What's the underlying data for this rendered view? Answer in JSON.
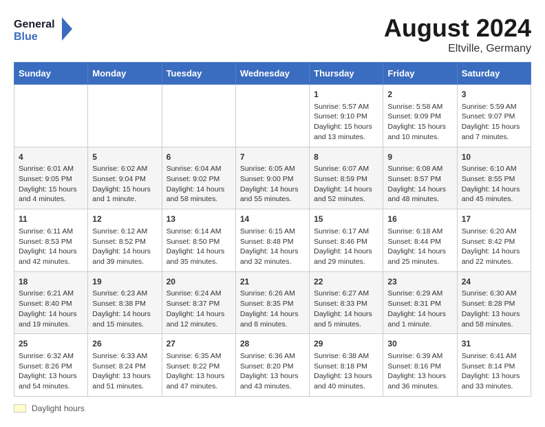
{
  "header": {
    "logo_general": "General",
    "logo_blue": "Blue",
    "month": "August 2024",
    "location": "Eltville, Germany"
  },
  "days_of_week": [
    "Sunday",
    "Monday",
    "Tuesday",
    "Wednesday",
    "Thursday",
    "Friday",
    "Saturday"
  ],
  "legend": {
    "label": "Daylight hours"
  },
  "weeks": [
    {
      "days": [
        {
          "num": "",
          "info": ""
        },
        {
          "num": "",
          "info": ""
        },
        {
          "num": "",
          "info": ""
        },
        {
          "num": "",
          "info": ""
        },
        {
          "num": "1",
          "info": "Sunrise: 5:57 AM\nSunset: 9:10 PM\nDaylight: 15 hours\nand 13 minutes."
        },
        {
          "num": "2",
          "info": "Sunrise: 5:58 AM\nSunset: 9:09 PM\nDaylight: 15 hours\nand 10 minutes."
        },
        {
          "num": "3",
          "info": "Sunrise: 5:59 AM\nSunset: 9:07 PM\nDaylight: 15 hours\nand 7 minutes."
        }
      ]
    },
    {
      "days": [
        {
          "num": "4",
          "info": "Sunrise: 6:01 AM\nSunset: 9:05 PM\nDaylight: 15 hours\nand 4 minutes."
        },
        {
          "num": "5",
          "info": "Sunrise: 6:02 AM\nSunset: 9:04 PM\nDaylight: 15 hours\nand 1 minute."
        },
        {
          "num": "6",
          "info": "Sunrise: 6:04 AM\nSunset: 9:02 PM\nDaylight: 14 hours\nand 58 minutes."
        },
        {
          "num": "7",
          "info": "Sunrise: 6:05 AM\nSunset: 9:00 PM\nDaylight: 14 hours\nand 55 minutes."
        },
        {
          "num": "8",
          "info": "Sunrise: 6:07 AM\nSunset: 8:59 PM\nDaylight: 14 hours\nand 52 minutes."
        },
        {
          "num": "9",
          "info": "Sunrise: 6:08 AM\nSunset: 8:57 PM\nDaylight: 14 hours\nand 48 minutes."
        },
        {
          "num": "10",
          "info": "Sunrise: 6:10 AM\nSunset: 8:55 PM\nDaylight: 14 hours\nand 45 minutes."
        }
      ]
    },
    {
      "days": [
        {
          "num": "11",
          "info": "Sunrise: 6:11 AM\nSunset: 8:53 PM\nDaylight: 14 hours\nand 42 minutes."
        },
        {
          "num": "12",
          "info": "Sunrise: 6:12 AM\nSunset: 8:52 PM\nDaylight: 14 hours\nand 39 minutes."
        },
        {
          "num": "13",
          "info": "Sunrise: 6:14 AM\nSunset: 8:50 PM\nDaylight: 14 hours\nand 35 minutes."
        },
        {
          "num": "14",
          "info": "Sunrise: 6:15 AM\nSunset: 8:48 PM\nDaylight: 14 hours\nand 32 minutes."
        },
        {
          "num": "15",
          "info": "Sunrise: 6:17 AM\nSunset: 8:46 PM\nDaylight: 14 hours\nand 29 minutes."
        },
        {
          "num": "16",
          "info": "Sunrise: 6:18 AM\nSunset: 8:44 PM\nDaylight: 14 hours\nand 25 minutes."
        },
        {
          "num": "17",
          "info": "Sunrise: 6:20 AM\nSunset: 8:42 PM\nDaylight: 14 hours\nand 22 minutes."
        }
      ]
    },
    {
      "days": [
        {
          "num": "18",
          "info": "Sunrise: 6:21 AM\nSunset: 8:40 PM\nDaylight: 14 hours\nand 19 minutes."
        },
        {
          "num": "19",
          "info": "Sunrise: 6:23 AM\nSunset: 8:38 PM\nDaylight: 14 hours\nand 15 minutes."
        },
        {
          "num": "20",
          "info": "Sunrise: 6:24 AM\nSunset: 8:37 PM\nDaylight: 14 hours\nand 12 minutes."
        },
        {
          "num": "21",
          "info": "Sunrise: 6:26 AM\nSunset: 8:35 PM\nDaylight: 14 hours\nand 8 minutes."
        },
        {
          "num": "22",
          "info": "Sunrise: 6:27 AM\nSunset: 8:33 PM\nDaylight: 14 hours\nand 5 minutes."
        },
        {
          "num": "23",
          "info": "Sunrise: 6:29 AM\nSunset: 8:31 PM\nDaylight: 14 hours\nand 1 minute."
        },
        {
          "num": "24",
          "info": "Sunrise: 6:30 AM\nSunset: 8:28 PM\nDaylight: 13 hours\nand 58 minutes."
        }
      ]
    },
    {
      "days": [
        {
          "num": "25",
          "info": "Sunrise: 6:32 AM\nSunset: 8:26 PM\nDaylight: 13 hours\nand 54 minutes."
        },
        {
          "num": "26",
          "info": "Sunrise: 6:33 AM\nSunset: 8:24 PM\nDaylight: 13 hours\nand 51 minutes."
        },
        {
          "num": "27",
          "info": "Sunrise: 6:35 AM\nSunset: 8:22 PM\nDaylight: 13 hours\nand 47 minutes."
        },
        {
          "num": "28",
          "info": "Sunrise: 6:36 AM\nSunset: 8:20 PM\nDaylight: 13 hours\nand 43 minutes."
        },
        {
          "num": "29",
          "info": "Sunrise: 6:38 AM\nSunset: 8:18 PM\nDaylight: 13 hours\nand 40 minutes."
        },
        {
          "num": "30",
          "info": "Sunrise: 6:39 AM\nSunset: 8:16 PM\nDaylight: 13 hours\nand 36 minutes."
        },
        {
          "num": "31",
          "info": "Sunrise: 6:41 AM\nSunset: 8:14 PM\nDaylight: 13 hours\nand 33 minutes."
        }
      ]
    }
  ]
}
